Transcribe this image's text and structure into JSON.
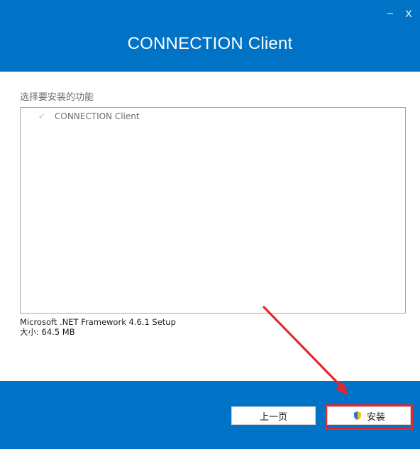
{
  "window": {
    "title": "CONNECTION Client",
    "minimize_glyph": "",
    "close_glyph": "X"
  },
  "features": {
    "section_label": "选择要安装的功能",
    "items": [
      {
        "label": "CONNECTION Client",
        "checked": true
      }
    ]
  },
  "info": {
    "description": "Microsoft .NET Framework 4.6.1 Setup",
    "size": "大小: 64.5 MB"
  },
  "buttons": {
    "back_label": "上一页",
    "install_label": "安装"
  },
  "icons": {
    "check": "check-icon",
    "install": "uac-shield-icon"
  },
  "colors": {
    "brand_blue": "#0173c6",
    "annotation_red": "#e3262f"
  }
}
